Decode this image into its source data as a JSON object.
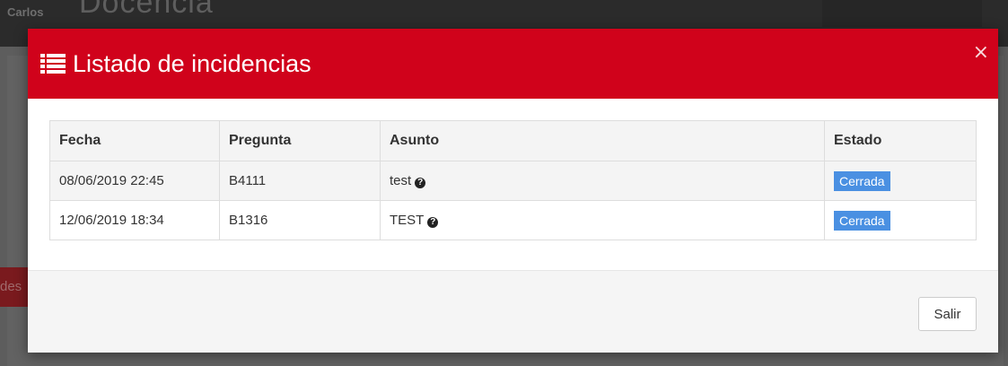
{
  "background": {
    "user_name": "Carlos",
    "app_title": "Docencia",
    "side_text": "des"
  },
  "modal": {
    "title": "Listado de incidencias",
    "title_icon": "list-icon",
    "close_label": "×",
    "accent_color": "#d0021b",
    "table": {
      "headers": [
        "Fecha",
        "Pregunta",
        "Asunto",
        "Estado"
      ],
      "rows": [
        {
          "fecha": "08/06/2019 22:45",
          "pregunta": "B4111",
          "asunto": "test",
          "estado": "Cerrada"
        },
        {
          "fecha": "12/06/2019 18:34",
          "pregunta": "B1316",
          "asunto": "TEST",
          "estado": "Cerrada"
        }
      ]
    },
    "status_color": "#4a90e2",
    "help_icon": "question-circle-icon",
    "footer": {
      "exit_label": "Salir"
    }
  }
}
